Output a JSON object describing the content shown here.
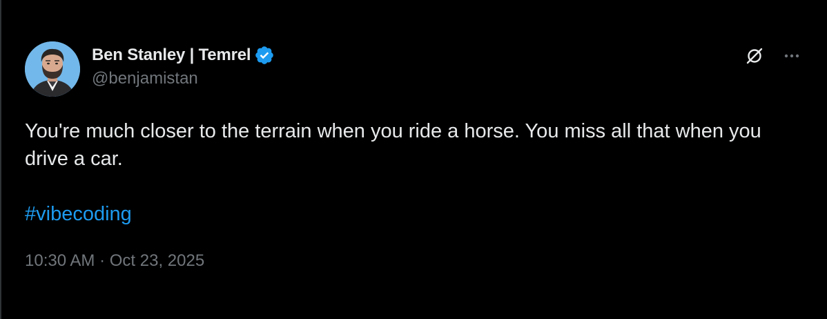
{
  "tweet": {
    "author": {
      "display_name": "Ben Stanley | Temrel",
      "handle": "@benjamistan",
      "verified": true,
      "avatar_icon": "avatar-photo"
    },
    "text": "You're much closer to the terrain when you ride a horse. You miss all that when you drive a car.",
    "hashtag": "#vibecoding",
    "time": "10:30 AM",
    "separator": "·",
    "date": "Oct 23, 2025"
  },
  "icons": {
    "verified": "verified-badge-icon",
    "grok": "grok-icon",
    "more": "more-options-icon"
  },
  "colors": {
    "background": "#000000",
    "text": "#e7e9ea",
    "muted": "#71767b",
    "accent": "#1d9bf0"
  }
}
